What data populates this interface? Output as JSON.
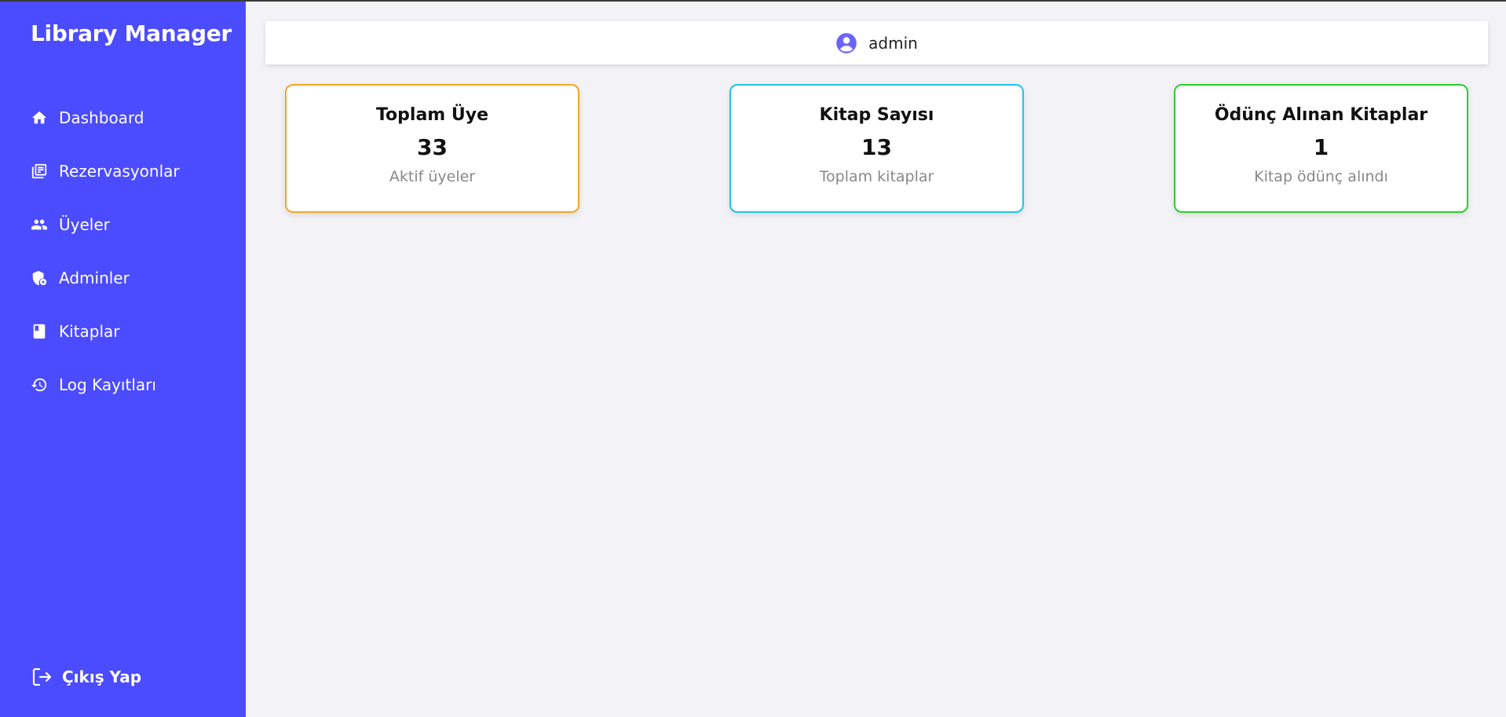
{
  "app": {
    "title": "Library Manager"
  },
  "sidebar": {
    "items": [
      {
        "label": "Dashboard",
        "icon": "home-icon"
      },
      {
        "label": "Rezervasyonlar",
        "icon": "reservations-icon"
      },
      {
        "label": "Üyeler",
        "icon": "users-icon"
      },
      {
        "label": "Adminler",
        "icon": "admin-shield-icon"
      },
      {
        "label": "Kitaplar",
        "icon": "book-icon"
      },
      {
        "label": "Log Kayıtları",
        "icon": "history-icon"
      }
    ],
    "logout_label": "Çıkış Yap"
  },
  "header": {
    "username": "admin"
  },
  "stats": [
    {
      "title": "Toplam Üye",
      "value": "33",
      "subtitle": "Aktif üyeler",
      "border_color": "#f5a623"
    },
    {
      "title": "Kitap Sayısı",
      "value": "13",
      "subtitle": "Toplam kitaplar",
      "border_color": "#1ec3f0"
    },
    {
      "title": "Ödünç Alınan Kitaplar",
      "value": "1",
      "subtitle": "Kitap ödünç alındı",
      "border_color": "#2ecc2e"
    }
  ],
  "colors": {
    "sidebar": "#4b4bff",
    "accent": "#6c63ff"
  }
}
